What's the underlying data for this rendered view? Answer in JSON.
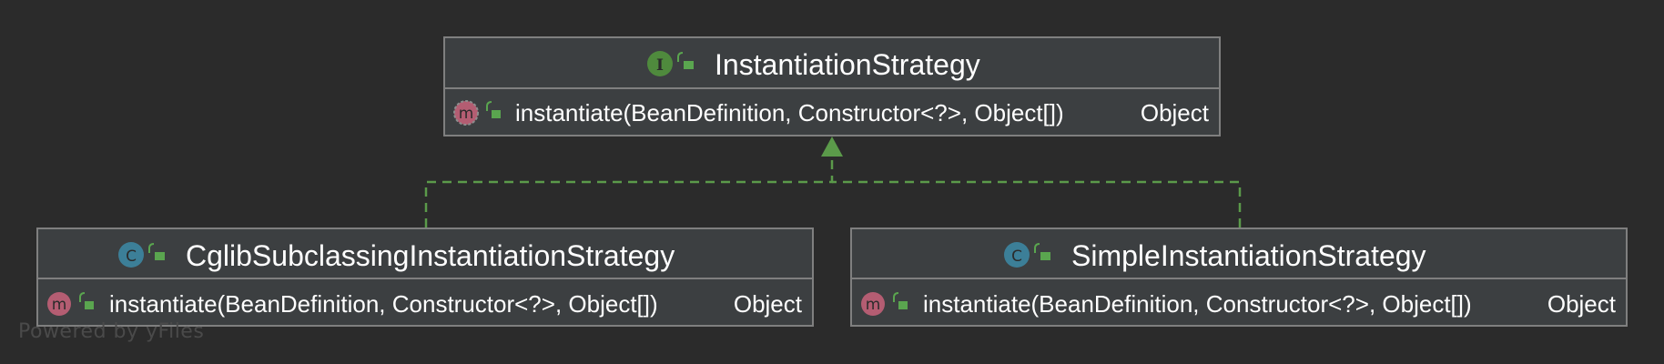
{
  "colors": {
    "background": "#2b2b2b",
    "box_fill": "#3c3f41",
    "box_border": "#7f7f7f",
    "text": "#ffffff",
    "connector": "#5b9a4a",
    "interface_badge": "#4f8a3d",
    "class_badge": "#3c7f98",
    "method_badge": "#b45d72",
    "public_lock": "#5aa54f"
  },
  "diagram": {
    "nodes": [
      {
        "id": "interface",
        "kind_icon": "interface-icon",
        "kind_letter": "I",
        "title": "InstantiationStrategy",
        "methods": [
          {
            "icon": "method-icon",
            "letter": "m",
            "signature": "instantiate(BeanDefinition, Constructor<?>, Object[])",
            "return_type": "Object",
            "abstract": true
          }
        ]
      },
      {
        "id": "cglib",
        "kind_icon": "class-icon",
        "kind_letter": "C",
        "title": "CglibSubclassingInstantiationStrategy",
        "methods": [
          {
            "icon": "method-icon",
            "letter": "m",
            "signature": "instantiate(BeanDefinition, Constructor<?>, Object[])",
            "return_type": "Object",
            "abstract": false
          }
        ]
      },
      {
        "id": "simple",
        "kind_icon": "class-icon",
        "kind_letter": "C",
        "title": "SimpleInstantiationStrategy",
        "methods": [
          {
            "icon": "method-icon",
            "letter": "m",
            "signature": "instantiate(BeanDefinition, Constructor<?>, Object[])",
            "return_type": "Object",
            "abstract": false
          }
        ]
      }
    ],
    "edges": [
      {
        "from": "cglib",
        "to": "interface",
        "style": "dashed",
        "arrow": "triangle"
      },
      {
        "from": "simple",
        "to": "interface",
        "style": "dashed",
        "arrow": "triangle"
      }
    ]
  },
  "watermark": "Powered by yFiles"
}
